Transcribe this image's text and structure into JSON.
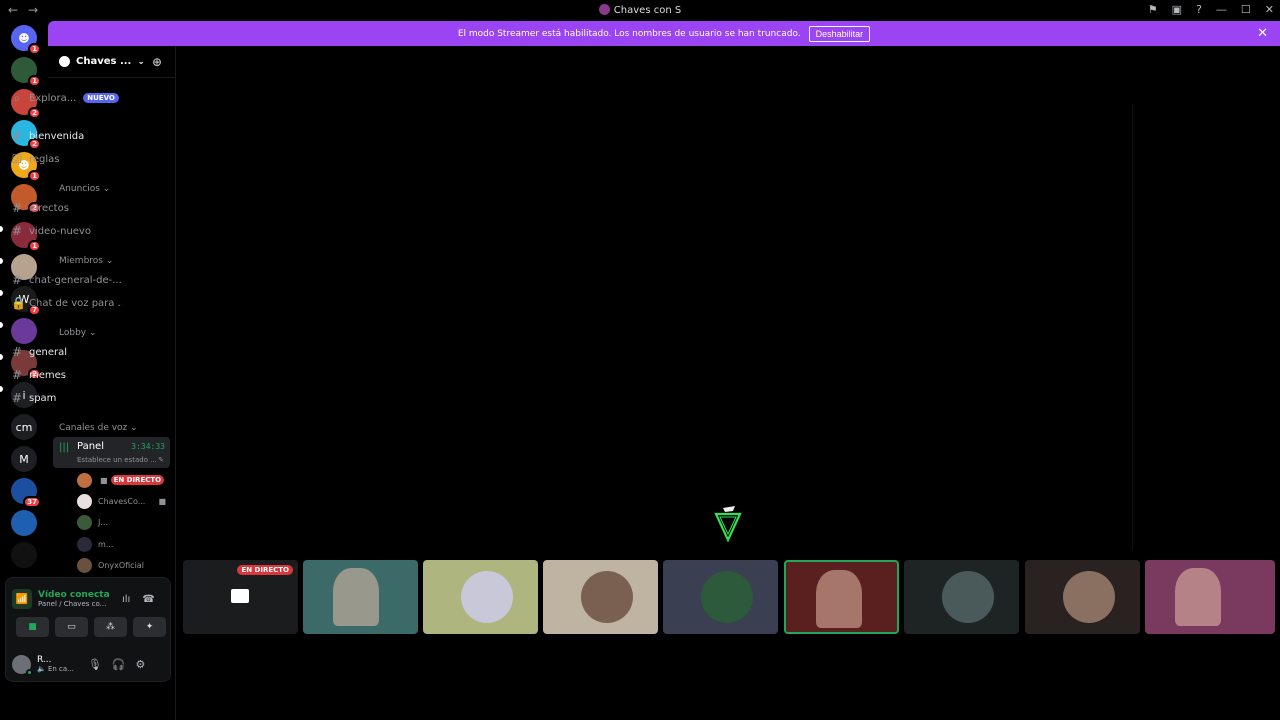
{
  "window": {
    "title": "Chaves con S",
    "back": "←",
    "forward": "→",
    "controls": {
      "inbox": "⚑",
      "screen": "▣",
      "help": "?",
      "minimize": "—",
      "maximize": "☐",
      "close": "✕"
    }
  },
  "banner": {
    "message": "El modo Streamer está habilitado. Los nombres de usuario se han truncado.",
    "button_label": "Deshabilitar",
    "close": "✕"
  },
  "guilds": [
    {
      "label": "",
      "color": "#5865f2",
      "badge": "1",
      "glyph": "☻"
    },
    {
      "label": "",
      "color": "#2e5a3a",
      "badge": "1",
      "glyph": ""
    },
    {
      "label": "",
      "color": "#c9443b",
      "badge": "2",
      "glyph": ""
    },
    {
      "label": "",
      "color": "#29b6e0",
      "badge": "2",
      "glyph": ""
    },
    {
      "label": "",
      "color": "#f0a81a",
      "badge": "1",
      "glyph": "☻"
    },
    {
      "label": "",
      "color": "#c25a2c",
      "badge": "2",
      "glyph": ""
    },
    {
      "label": "",
      "color": "#8a2b3c",
      "badge": "1",
      "glyph": ""
    },
    {
      "label": "",
      "color": "#b7a28e",
      "badge": "",
      "glyph": ""
    },
    {
      "label": "",
      "color": "#1b1b1b",
      "badge": "7",
      "glyph": "W"
    },
    {
      "label": "",
      "color": "#6a3a9a",
      "badge": "",
      "glyph": ""
    },
    {
      "label": "",
      "color": "#7a3a3a",
      "badge": "2",
      "glyph": ""
    },
    {
      "label": "i",
      "color": "#1e1f22",
      "badge": "",
      "glyph": ""
    },
    {
      "label": "cm",
      "color": "#1e1f22",
      "badge": "",
      "glyph": ""
    },
    {
      "label": "M",
      "color": "#1e1f22",
      "badge": "",
      "glyph": ""
    },
    {
      "label": "",
      "color": "#1c4fa0",
      "badge": "37",
      "glyph": ""
    },
    {
      "label": "",
      "color": "#1f5fb0",
      "badge": "",
      "glyph": ""
    },
    {
      "label": "",
      "color": "#111",
      "badge": "",
      "glyph": ""
    }
  ],
  "server": {
    "name": "Chaves ...",
    "chevron": "⌄",
    "invite_icon": "⊕"
  },
  "explore": {
    "label": "Explora...",
    "badge": "NUEVO"
  },
  "channels_top": [
    {
      "name": "bienvenida",
      "icon": "#",
      "bright": true
    },
    {
      "name": "reglas",
      "icon": "☑",
      "bright": false
    }
  ],
  "categories": {
    "anuncios": "Anuncios ⌄",
    "miembros": "Miembros ⌄",
    "lobby": "Lobby ⌄",
    "voz": "Canales de voz ⌄"
  },
  "channels_anuncios": [
    {
      "name": "directos",
      "icon": "#"
    },
    {
      "name": "video-nuevo",
      "icon": "#"
    }
  ],
  "channels_miembros": [
    {
      "name": "chat-general-de-...",
      "icon": "#"
    },
    {
      "name": "Chat de voz para ...",
      "icon": "🔒"
    }
  ],
  "channels_lobby": [
    {
      "name": "general",
      "icon": "#"
    },
    {
      "name": "memes",
      "icon": "#"
    },
    {
      "name": "spam",
      "icon": "#"
    }
  ],
  "voice_channel": {
    "name": "Panel",
    "timer": "3:34:33",
    "status": "Establece un estado ...",
    "icon": "|||",
    "pencil": "✎"
  },
  "voice_users": [
    {
      "name": "",
      "live": "EN DIRECTO",
      "cam": true,
      "color": "#c07040"
    },
    {
      "name": "ChavesCo...",
      "live": "",
      "cam": true,
      "color": "#e8e0e0"
    },
    {
      "name": "J...",
      "live": "",
      "cam": false,
      "color": "#3a5a3a"
    },
    {
      "name": "m...",
      "live": "",
      "cam": false,
      "color": "#2a2a3a"
    },
    {
      "name": "OnyxOficial",
      "live": "",
      "cam": false,
      "color": "#6a5040"
    }
  ],
  "panel_voice": {
    "status": "Vídeo conectad",
    "location": "Panel / Chaves co...",
    "signal_icon": "📶",
    "wave_icon": "ılı",
    "hangup_icon": "☎",
    "buttons": [
      "■",
      "▭",
      "⁂",
      "✦"
    ]
  },
  "user_panel": {
    "name": "R...",
    "status": "🔈 En ca...",
    "mic": "🎙",
    "headset": "🎧",
    "settings": "⚙"
  },
  "tiles": [
    {
      "kind": "screen",
      "bg": "#1a1c1e",
      "live": "EN DIRECTO",
      "avatar_color": ""
    },
    {
      "kind": "cam",
      "bg": "#3c6a68",
      "live": "",
      "avatar_color": ""
    },
    {
      "kind": "avatar",
      "bg": "#aeb57f",
      "live": "",
      "avatar_color": "#c8c8d8"
    },
    {
      "kind": "avatar",
      "bg": "#bfb3a2",
      "live": "",
      "avatar_color": "#7a6050"
    },
    {
      "kind": "avatar",
      "bg": "#3b3f52",
      "live": "",
      "avatar_color": "#2c5a3a"
    },
    {
      "kind": "cam",
      "bg": "#5a2020",
      "live": "",
      "avatar_color": ""
    },
    {
      "kind": "avatar",
      "bg": "#1e2424",
      "live": "",
      "avatar_color": "#4a5a5a"
    },
    {
      "kind": "avatar",
      "bg": "#2a2220",
      "live": "",
      "avatar_color": "#8a7060"
    },
    {
      "kind": "cam",
      "bg": "#7a3a60",
      "live": "",
      "avatar_color": ""
    }
  ],
  "colors": {
    "accent_purple": "#9b44f4",
    "live_red": "#da373c",
    "voice_green": "#23a55a",
    "blurple": "#5865f2"
  }
}
